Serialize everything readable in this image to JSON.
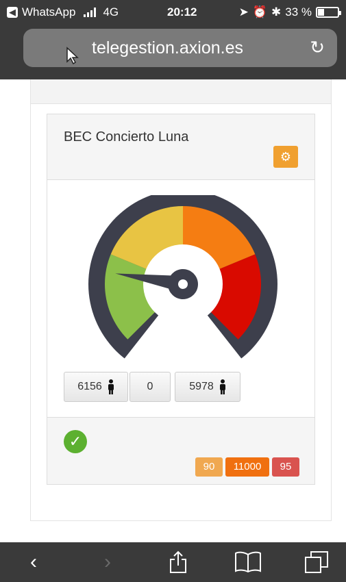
{
  "status_bar": {
    "back_app": "WhatsApp",
    "network": "4G",
    "time": "20:12",
    "battery": "33 %",
    "battery_level": 0.33
  },
  "browser": {
    "url": "telegestion.axion.es"
  },
  "panel": {
    "title": "BEC Concierto Luna",
    "gauge": {
      "segments": [
        {
          "color": "#8cc04a"
        },
        {
          "color": "#e8c443"
        },
        {
          "color": "#f57d12"
        },
        {
          "color": "#d90a00"
        }
      ],
      "needle_value": 0.2
    },
    "counters": [
      {
        "value": "6156",
        "icon": "person-icon"
      },
      {
        "value": "0"
      },
      {
        "value": "5978",
        "icon": "person-icon"
      }
    ],
    "badges": [
      {
        "label": "90",
        "color": "#f0a850"
      },
      {
        "label": "11000",
        "color": "#f07010"
      },
      {
        "label": "95",
        "color": "#d9534f"
      }
    ]
  },
  "toolbar": {
    "back": "‹",
    "forward": "›"
  }
}
